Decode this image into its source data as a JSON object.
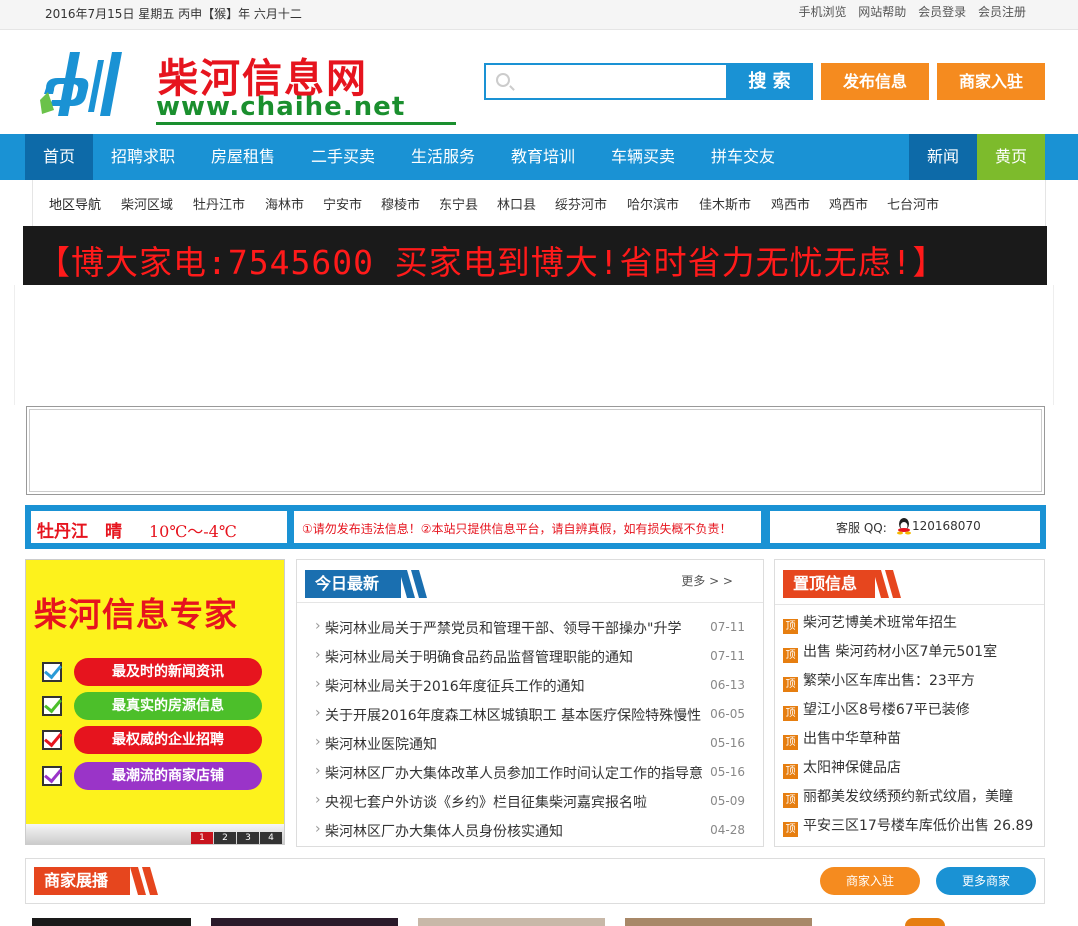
{
  "topbar": {
    "date": "2016年7月15日 星期五  丙申【猴】年 六月十二",
    "links": [
      "手机浏览",
      "网站帮助",
      "会员登录",
      "会员注册"
    ]
  },
  "header": {
    "logo_title": "柴河信息网",
    "logo_url": "www.chaihe.net",
    "search_placeholder": "",
    "search_button": "搜 索",
    "publish_button": "发布信息",
    "merchant_button": "商家入驻"
  },
  "nav": {
    "items": [
      "首页",
      "招聘求职",
      "房屋租售",
      "二手买卖",
      "生活服务",
      "教育培训",
      "车辆买卖",
      "拼车交友"
    ],
    "right_items": [
      "新闻",
      "黄页"
    ]
  },
  "region": {
    "label": "地区导航",
    "items": [
      "柴河区域",
      "牡丹江市",
      "海林市",
      "宁安市",
      "穆棱市",
      "东宁县",
      "林口县",
      "绥芬河市",
      "哈尔滨市",
      "佳木斯市",
      "鸡西市",
      "鸡西市",
      "七台河市"
    ]
  },
  "banner": {
    "text": "【博大家电:7545600 买家电到博大!省时省力无忧无虑!】"
  },
  "strip": {
    "city": "牡丹江　晴",
    "temp": "10℃～-4℃",
    "notice": "①请勿发布违法信息！②本站只提供信息平台，请自辨真假，如有损失概不负责！",
    "service_label": "客服 QQ:",
    "service_qq": "120168070"
  },
  "promo": {
    "title": "柴河信息专家",
    "bars": [
      {
        "text": "最及时的新闻资讯",
        "color": "#e6141e",
        "check": "#2a9bd7"
      },
      {
        "text": "最真实的房源信息",
        "color": "#4cbf2a",
        "check": "#4cbf2a"
      },
      {
        "text": "最权威的企业招聘",
        "color": "#e6141e",
        "check": "#e6141e"
      },
      {
        "text": "最潮流的商家店铺",
        "color": "#9a34c8",
        "check": "#9a34c8"
      }
    ],
    "pager": [
      "1",
      "2",
      "3",
      "4"
    ]
  },
  "latest": {
    "title": "今日最新",
    "more": "更多 > >",
    "rows": [
      {
        "title": "柴河林业局关于严禁党员和管理干部、领导干部操办\"升学",
        "date": "07-11"
      },
      {
        "title": "柴河林业局关于明确食品药品监督管理职能的通知",
        "date": "07-11"
      },
      {
        "title": "柴河林业局关于2016年度征兵工作的通知",
        "date": "06-13"
      },
      {
        "title": "关于开展2016年度森工林区城镇职工 基本医疗保险特殊慢性",
        "date": "06-05"
      },
      {
        "title": "柴河林业医院通知",
        "date": "05-16"
      },
      {
        "title": "柴河林区厂办大集体改革人员参加工作时间认定工作的指导意",
        "date": "05-16"
      },
      {
        "title": "央视七套户外访谈《乡约》栏目征集柴河嘉宾报名啦",
        "date": "05-09"
      },
      {
        "title": "柴河林区厂办大集体人员身份核实通知",
        "date": "04-28"
      }
    ]
  },
  "pinned": {
    "title": "置顶信息",
    "badge": "顶",
    "rows": [
      "柴河艺博美术班常年招生",
      "出售 柴河药材小区7单元501室",
      "繁荣小区车库出售：23平方",
      "望江小区8号楼67平已装修",
      "出售中华草种苗",
      "太阳神保健品店",
      "丽都美发纹绣预约新式纹眉，美瞳",
      "平安三区17号楼车库低价出售 26.89"
    ]
  },
  "merchants": {
    "title": "商家展播",
    "join_button": "商家入驻",
    "more_button": "更多商家"
  },
  "colors": {
    "accent": "#1a92d4",
    "orange": "#f58b1f",
    "red": "#e6141e",
    "green": "#7dbb2c"
  }
}
